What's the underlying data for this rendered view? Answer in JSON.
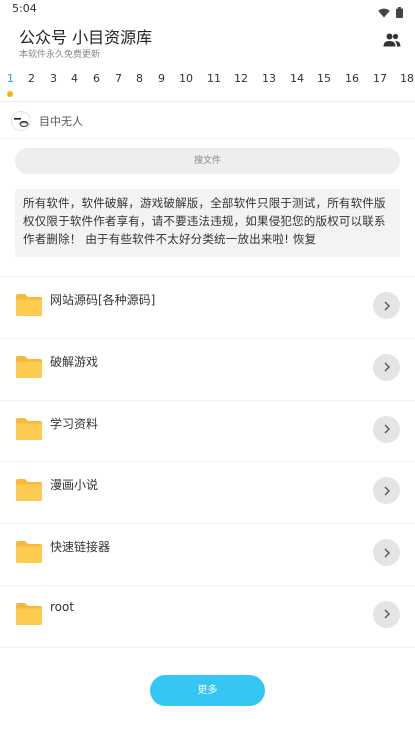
{
  "status_bar": {
    "time": "5:04"
  },
  "header": {
    "title": "公众号 小目资源库",
    "subtitle": "本软件永久免费更新"
  },
  "page_tabs": [
    "1",
    "2",
    "3",
    "4",
    "6",
    "7",
    "8",
    "9",
    "10",
    "11",
    "12",
    "13",
    "14",
    "15",
    "16",
    "17",
    "18"
  ],
  "active_tab": "1",
  "user": {
    "name": "目中无人"
  },
  "search": {
    "placeholder": "搜文件"
  },
  "notice": {
    "text": "所有软件，软件破解，游戏破解版，全部软件只限于测试，所有软件版权仅限于软件作者享有，请不要违法违规，如果侵犯您的版权可以联系作者删除！ 由于有些软件不太好分类统一放出来啦! 恢复"
  },
  "folders": [
    {
      "label": "网站源码[各种源码]"
    },
    {
      "label": "破解游戏"
    },
    {
      "label": "学习资料"
    },
    {
      "label": "漫画小说"
    },
    {
      "label": "快速链接器"
    },
    {
      "label": "root"
    }
  ],
  "more_button": {
    "label": "更多"
  },
  "colors": {
    "accent": "#36c6f4",
    "tab_active": "#2a9ed8",
    "tab_indicator": "#f5b800",
    "folder": "#fdcb4f"
  },
  "icons": {
    "wifi": "wifi-icon",
    "battery": "battery-icon",
    "users": "users-icon",
    "folder": "folder-icon",
    "chevron": "chevron-right-icon"
  }
}
